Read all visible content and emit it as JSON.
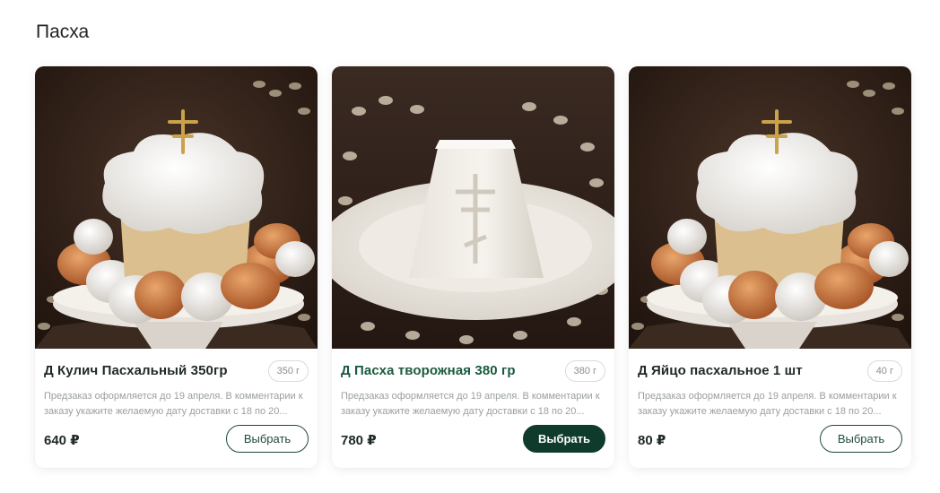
{
  "section": {
    "title": "Пасха"
  },
  "products": [
    {
      "name": "Д Кулич Пасхальный 350гр",
      "weight": "350 г",
      "description": "Предзаказ оформляется до 19 апреля. В комментарии к заказу укажите желаемую дату доставки с 18 по 20...",
      "price": "640 ₽",
      "button": "Выбрать",
      "image": "kulich-with-eggs",
      "button_style": "outline"
    },
    {
      "name": "Д Пасха творожная 380 гр",
      "weight": "380 г",
      "description": "Предзаказ оформляется до 19 апреля. В комментарии к заказу укажите желаемую дату доставки с 18 по 20...",
      "price": "780 ₽",
      "button": "Выбрать",
      "image": "cottage-cheese-paskha",
      "button_style": "solid"
    },
    {
      "name": "Д Яйцо пасхальное 1 шт",
      "weight": "40 г",
      "description": "Предзаказ оформляется до 19 апреля. В комментарии к заказу укажите желаемую дату доставки с 18 по 20...",
      "price": "80 ₽",
      "button": "Выбрать",
      "image": "kulich-with-eggs",
      "button_style": "outline"
    }
  ],
  "colors": {
    "accent": "#0f3b2d",
    "accent_text": "#1a5a3f",
    "muted_text": "#9aa09d"
  }
}
